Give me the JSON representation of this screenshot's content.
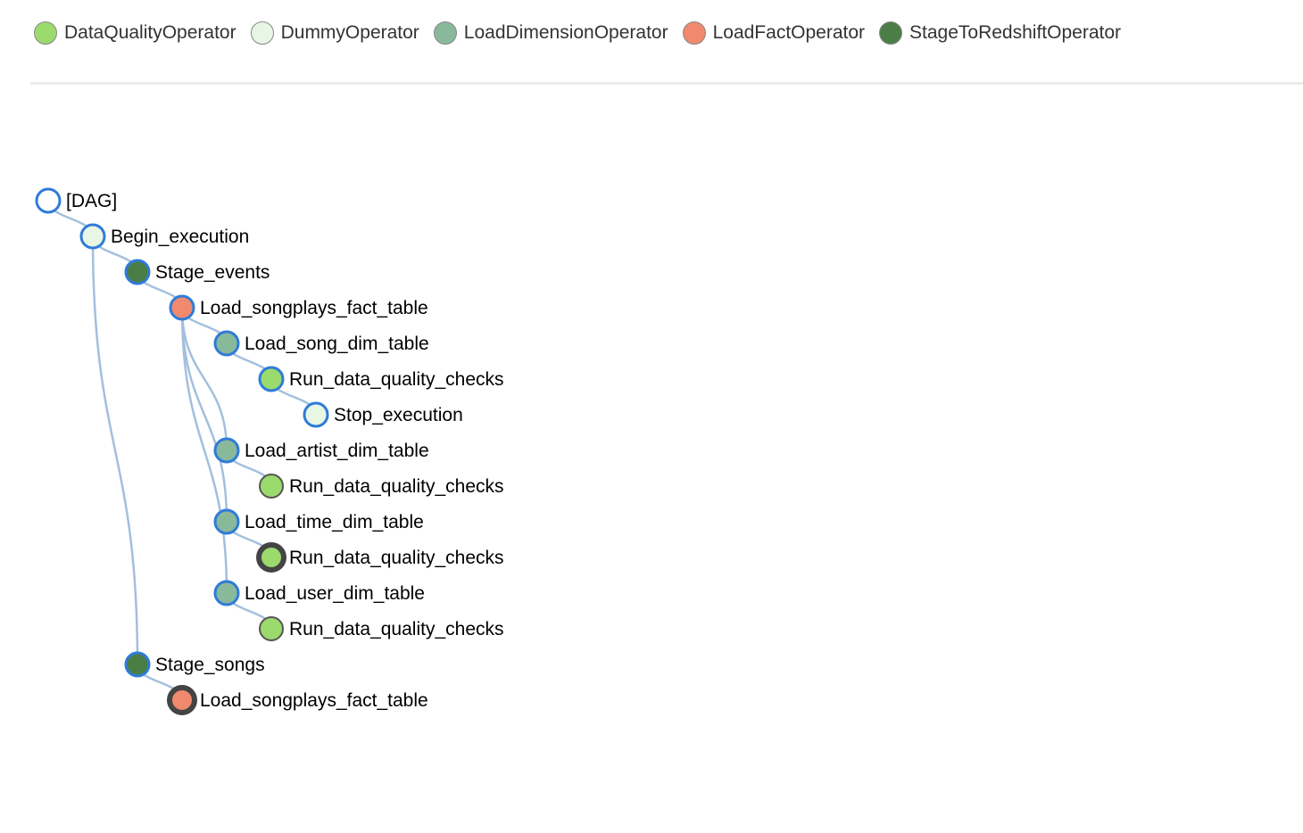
{
  "legend": [
    {
      "label": "DataQualityOperator",
      "color": "#9bda6c"
    },
    {
      "label": "DummyOperator",
      "color": "#e8f7e4"
    },
    {
      "label": "LoadDimensionOperator",
      "color": "#89b99b"
    },
    {
      "label": "LoadFactOperator",
      "color": "#f0896d"
    },
    {
      "label": "StageToRedshiftOperator",
      "color": "#4b7e46"
    }
  ],
  "tree": {
    "nodes": [
      {
        "label": "[DAG]",
        "depth": 0,
        "parent": -1,
        "color": "#ffffff",
        "ring": "blue"
      },
      {
        "label": "Begin_execution",
        "depth": 1,
        "parent": 0,
        "color": "#e8f7e4",
        "ring": "blue"
      },
      {
        "label": "Stage_events",
        "depth": 2,
        "parent": 1,
        "color": "#4b7e46",
        "ring": "blue"
      },
      {
        "label": "Load_songplays_fact_table",
        "depth": 3,
        "parent": 2,
        "color": "#f0896d",
        "ring": "blue"
      },
      {
        "label": "Load_song_dim_table",
        "depth": 4,
        "parent": 3,
        "color": "#89b99b",
        "ring": "blue"
      },
      {
        "label": "Run_data_quality_checks",
        "depth": 5,
        "parent": 4,
        "color": "#9bda6c",
        "ring": "blue"
      },
      {
        "label": "Stop_execution",
        "depth": 6,
        "parent": 5,
        "color": "#e8f7e4",
        "ring": "blue"
      },
      {
        "label": "Load_artist_dim_table",
        "depth": 4,
        "parent": 3,
        "color": "#89b99b",
        "ring": "blue"
      },
      {
        "label": "Run_data_quality_checks",
        "depth": 5,
        "parent": 7,
        "color": "#9bda6c",
        "ring": "gray"
      },
      {
        "label": "Load_time_dim_table",
        "depth": 4,
        "parent": 3,
        "color": "#89b99b",
        "ring": "blue"
      },
      {
        "label": "Run_data_quality_checks",
        "depth": 5,
        "parent": 9,
        "color": "#9bda6c",
        "ring": "dark"
      },
      {
        "label": "Load_user_dim_table",
        "depth": 4,
        "parent": 3,
        "color": "#89b99b",
        "ring": "blue"
      },
      {
        "label": "Run_data_quality_checks",
        "depth": 5,
        "parent": 11,
        "color": "#9bda6c",
        "ring": "gray"
      },
      {
        "label": "Stage_songs",
        "depth": 2,
        "parent": 1,
        "color": "#4b7e46",
        "ring": "blue"
      },
      {
        "label": "Load_songplays_fact_table",
        "depth": 3,
        "parent": 13,
        "color": "#f0896d",
        "ring": "dark"
      }
    ]
  }
}
